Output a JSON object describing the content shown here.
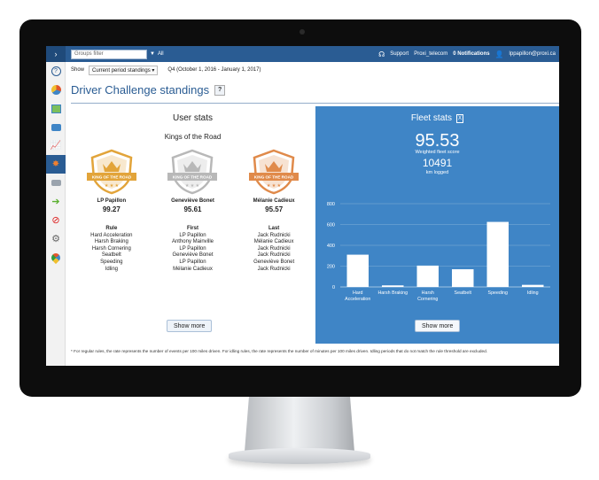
{
  "topbar": {
    "groups_placeholder": "Groups filter",
    "groups_all": "All",
    "support": "Support",
    "account": "Proxi_telecom",
    "notifications": "0 Notifications",
    "user_email": "lppapillon@proxi.ca"
  },
  "filter": {
    "show_label": "Show",
    "period_select": "Current period standings",
    "period_text": "Q4 (October 1, 2016 - January 1, 2017)"
  },
  "page": {
    "title": "Driver Challenge standings",
    "help": "?"
  },
  "user_stats": {
    "title": "User stats",
    "subtitle": "Kings of the Road",
    "badge_text": "KING OF THE ROAD",
    "winners": [
      {
        "name": "LP Papillon",
        "score": "99.27",
        "color": "#e2a43a"
      },
      {
        "name": "Geneviève Bonet",
        "score": "95.61",
        "color": "#b8b8b8"
      },
      {
        "name": "Mélanie Cadieux",
        "score": "95.57",
        "color": "#e08a4a"
      }
    ],
    "rules": {
      "rule_header": "Rule",
      "first_header": "First",
      "last_header": "Last",
      "rule": [
        "Hard Acceleration",
        "Harsh Braking",
        "Harsh Cornering",
        "Seatbelt",
        "Speeding",
        "Idling"
      ],
      "first": [
        "LP Papillon",
        "Anthony Mainville",
        "LP Papillon",
        "Geneviève Bonet",
        "LP Papillon",
        "Mélanie Cadieux"
      ],
      "last": [
        "Jack Rudnicki",
        "Mélanie Cadieux",
        "Jack Rudnicki",
        "Jack Rudnicki",
        "Geneviève Bonet",
        "Jack Rudnicki"
      ]
    },
    "show_more": "Show more"
  },
  "fleet_stats": {
    "title": "Fleet stats",
    "score": "95.53",
    "score_label": "Weighted fleet score",
    "km": "10491",
    "km_label": "km logged",
    "show_more": "Show more",
    "background": "#3f85c6"
  },
  "chart_data": {
    "type": "bar",
    "categories": [
      "Hard Acceleration",
      "Harsh Braking",
      "Harsh Cornering",
      "Seatbelt",
      "Speeding",
      "Idling"
    ],
    "values": [
      310,
      15,
      205,
      170,
      625,
      20
    ],
    "ylim": [
      0,
      800
    ],
    "yticks": [
      0,
      200,
      400,
      600,
      800
    ],
    "grid": true
  },
  "footnote": "* For regular rules, the rate represents the number of events per 100 miles driven. For idling rules, the rate represents the number of minutes per 100 miles driven. Idling periods that do not match the rule threshold are excluded.",
  "sidebar_icons": [
    "help-icon",
    "pie-chart-icon",
    "map-icon",
    "messages-icon",
    "trend-chart-icon",
    "trophy-icon",
    "vehicles-icon",
    "route-arrow-icon",
    "exceptions-icon",
    "settings-icon",
    "location-icon"
  ]
}
